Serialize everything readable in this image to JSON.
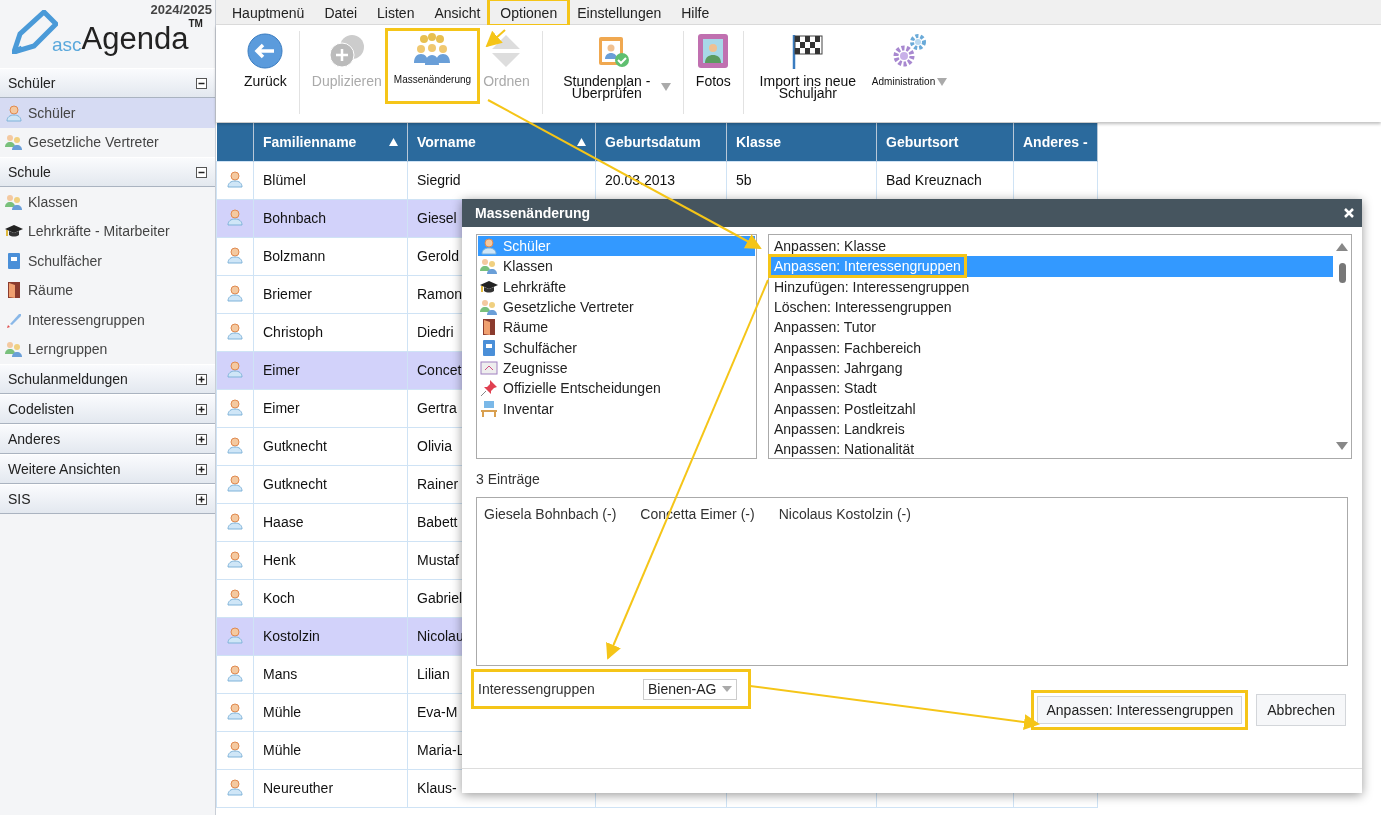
{
  "app": {
    "year": "2024/2025",
    "logo": {
      "prefix": "asc",
      "name": "Agenda",
      "mark": "TM"
    }
  },
  "sidebar": {
    "sections": [
      {
        "title": "Schüler",
        "expanded": true,
        "items": [
          {
            "label": "Schüler",
            "selected": true
          },
          {
            "label": "Gesetzliche Vertreter",
            "selected": false
          }
        ]
      },
      {
        "title": "Schule",
        "expanded": true,
        "items": [
          {
            "label": "Klassen",
            "selected": false
          },
          {
            "label": "Lehrkräfte - Mitarbeiter",
            "selected": false
          },
          {
            "label": "Schulfächer",
            "selected": false
          },
          {
            "label": "Räume",
            "selected": false
          },
          {
            "label": "Interessengruppen",
            "selected": false
          },
          {
            "label": "Lerngruppen",
            "selected": false
          }
        ]
      },
      {
        "title": "Schulanmeldungen",
        "expanded": false
      },
      {
        "title": "Codelisten",
        "expanded": false
      },
      {
        "title": "Anderes",
        "expanded": false
      },
      {
        "title": "Weitere Ansichten",
        "expanded": false
      },
      {
        "title": "SIS",
        "expanded": false
      }
    ]
  },
  "menu": [
    {
      "label": "Hauptmenü",
      "highlighted": false
    },
    {
      "label": "Datei",
      "highlighted": false
    },
    {
      "label": "Listen",
      "highlighted": false
    },
    {
      "label": "Ansicht",
      "highlighted": false
    },
    {
      "label": "Optionen",
      "highlighted": true
    },
    {
      "label": "Einstellungen",
      "highlighted": false
    },
    {
      "label": "Hilfe",
      "highlighted": false
    }
  ],
  "toolbar": [
    {
      "label": "Zurück",
      "kind": "normal",
      "disabled": false,
      "highlighted": false,
      "dropdown": false,
      "divider_after": true
    },
    {
      "label": "Duplizieren",
      "kind": "normal",
      "disabled": true,
      "highlighted": false,
      "dropdown": false,
      "divider_after": false
    },
    {
      "label": "Massenänderung",
      "kind": "compact",
      "disabled": false,
      "highlighted": true,
      "dropdown": false,
      "divider_after": false
    },
    {
      "label": "Ordnen",
      "kind": "normal",
      "disabled": true,
      "highlighted": false,
      "dropdown": false,
      "divider_after": true
    },
    {
      "label": "Stundenplan - Überprüfen",
      "kind": "normal",
      "disabled": false,
      "highlighted": false,
      "dropdown": true,
      "divider_after": true
    },
    {
      "label": "Fotos",
      "kind": "normal",
      "disabled": false,
      "highlighted": false,
      "dropdown": false,
      "divider_after": true
    },
    {
      "label": "Import ins neue Schuljahr",
      "kind": "normal",
      "disabled": false,
      "highlighted": false,
      "dropdown": false,
      "divider_after": false
    },
    {
      "label": "Administration",
      "kind": "compact",
      "disabled": false,
      "highlighted": false,
      "dropdown": true,
      "divider_after": false
    }
  ],
  "table": {
    "columns": [
      {
        "label": "Familienname",
        "sorted": true
      },
      {
        "label": "Vorname",
        "sorted": true
      },
      {
        "label": "Geburtsdatum",
        "sorted": false
      },
      {
        "label": "Klasse",
        "sorted": false
      },
      {
        "label": "Geburtsort",
        "sorted": false
      },
      {
        "label": "Anderes -",
        "sorted": false
      }
    ],
    "rows": [
      {
        "selected": false,
        "cells": [
          "Blümel",
          "Siegrid",
          "20.03.2013",
          "5b",
          "Bad Kreuznach"
        ]
      },
      {
        "selected": true,
        "cells": [
          "Bohnbach",
          "Giesel"
        ]
      },
      {
        "selected": false,
        "cells": [
          "Bolzmann",
          "Gerold"
        ]
      },
      {
        "selected": false,
        "cells": [
          "Briemer",
          "Ramon"
        ]
      },
      {
        "selected": false,
        "cells": [
          "Christoph",
          "Diedri"
        ]
      },
      {
        "selected": true,
        "cells": [
          "Eimer",
          "Concet"
        ]
      },
      {
        "selected": false,
        "cells": [
          "Eimer",
          "Gertra"
        ]
      },
      {
        "selected": false,
        "cells": [
          "Gutknecht",
          "Olivia"
        ]
      },
      {
        "selected": false,
        "cells": [
          "Gutknecht",
          "Rainer"
        ]
      },
      {
        "selected": false,
        "cells": [
          "Haase",
          "Babett"
        ]
      },
      {
        "selected": false,
        "cells": [
          "Henk",
          "Mustaf"
        ]
      },
      {
        "selected": false,
        "cells": [
          "Koch",
          "Gabriel"
        ]
      },
      {
        "selected": true,
        "cells": [
          "Kostolzin",
          "Nicolau"
        ]
      },
      {
        "selected": false,
        "cells": [
          "Mans",
          "Lilian"
        ]
      },
      {
        "selected": false,
        "cells": [
          "Mühle",
          "Eva-M"
        ]
      },
      {
        "selected": false,
        "cells": [
          "Mühle",
          "Maria-L"
        ]
      },
      {
        "selected": false,
        "cells": [
          "Neureuther",
          "Klaus-"
        ]
      }
    ]
  },
  "dialog": {
    "title": "Massenänderung",
    "categories": [
      {
        "label": "Schüler",
        "selected": true
      },
      {
        "label": "Klassen",
        "selected": false
      },
      {
        "label": "Lehrkräfte",
        "selected": false
      },
      {
        "label": "Gesetzliche Vertreter",
        "selected": false
      },
      {
        "label": "Räume",
        "selected": false
      },
      {
        "label": "Schulfächer",
        "selected": false
      },
      {
        "label": "Zeugnisse",
        "selected": false
      },
      {
        "label": "Offizielle Entscheidungen",
        "selected": false
      },
      {
        "label": "Inventar",
        "selected": false
      }
    ],
    "actions": [
      {
        "label": "Anpassen: Klasse",
        "selected": false,
        "highlighted": false
      },
      {
        "label": "Anpassen: Interessengruppen",
        "selected": true,
        "highlighted": true
      },
      {
        "label": "Hinzufügen: Interessengruppen",
        "selected": false,
        "highlighted": false
      },
      {
        "label": "Löschen: Interessengruppen",
        "selected": false,
        "highlighted": false
      },
      {
        "label": "Anpassen: Tutor",
        "selected": false,
        "highlighted": false
      },
      {
        "label": "Anpassen: Fachbereich",
        "selected": false,
        "highlighted": false
      },
      {
        "label": "Anpassen: Jahrgang",
        "selected": false,
        "highlighted": false
      },
      {
        "label": "Anpassen: Stadt",
        "selected": false,
        "highlighted": false
      },
      {
        "label": "Anpassen: Postleitzahl",
        "selected": false,
        "highlighted": false
      },
      {
        "label": "Anpassen: Landkreis",
        "selected": false,
        "highlighted": false
      },
      {
        "label": "Anpassen: Nationalität",
        "selected": false,
        "highlighted": false
      }
    ],
    "count": "3 Einträge",
    "entries": [
      "Giesela Bohnbach (-)",
      "Concetta Eimer (-)",
      "Nicolaus Kostolzin (-)"
    ],
    "field": {
      "label": "Interessengruppen",
      "value": "Bienen-AG",
      "highlighted": true
    },
    "buttons": [
      {
        "label": "Anpassen: Interessengruppen",
        "kind": "primary",
        "highlighted": true
      },
      {
        "label": "Abbrechen",
        "kind": "secondary",
        "highlighted": false
      }
    ]
  }
}
